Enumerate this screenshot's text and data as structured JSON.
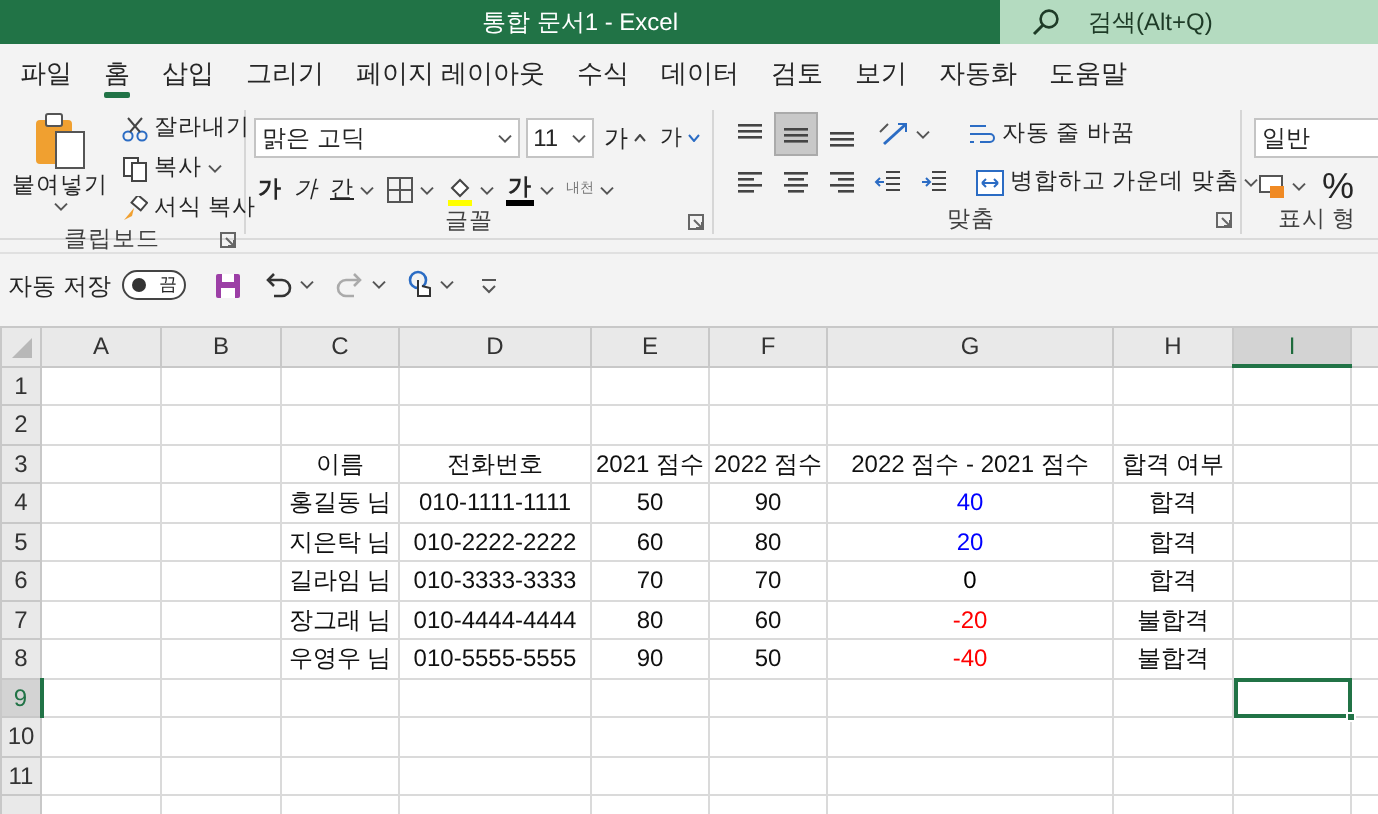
{
  "window": {
    "title": "통합 문서1  -  Excel"
  },
  "search": {
    "placeholder": "검색(Alt+Q)"
  },
  "tabs": [
    {
      "label": "파일",
      "selected": false
    },
    {
      "label": "홈",
      "selected": true
    },
    {
      "label": "삽입",
      "selected": false
    },
    {
      "label": "그리기",
      "selected": false
    },
    {
      "label": "페이지 레이아웃",
      "selected": false
    },
    {
      "label": "수식",
      "selected": false
    },
    {
      "label": "데이터",
      "selected": false
    },
    {
      "label": "검토",
      "selected": false
    },
    {
      "label": "보기",
      "selected": false
    },
    {
      "label": "자동화",
      "selected": false
    },
    {
      "label": "도움말",
      "selected": false
    }
  ],
  "ribbon": {
    "clipboard": {
      "paste": "붙여넣기",
      "cut": "잘라내기",
      "copy": "복사",
      "format_painter": "서식 복사",
      "label": "클립보드"
    },
    "font": {
      "font_name": "맑은 고딕",
      "font_size": "11",
      "grow": "가",
      "shrink": "가",
      "bold": "가",
      "italic": "가",
      "underline": "간",
      "font_color": "가",
      "phonetic": "내천",
      "label": "글꼴"
    },
    "alignment": {
      "vertical_align": [
        {
          "kind": "top",
          "selected": false
        },
        {
          "kind": "middle",
          "selected": true
        },
        {
          "kind": "bottom",
          "selected": false
        }
      ],
      "wrap_text": "자동 줄 바꿈",
      "merge": "병합하고 가운데 맞춤",
      "label": "맞춤"
    },
    "number": {
      "format": "일반",
      "percent": "%",
      "label": "표시 형"
    }
  },
  "quick_access": {
    "autosave_label": "자동 저장",
    "autosave_on": false,
    "autosave_state": "끔"
  },
  "sheet": {
    "columns": [
      {
        "label": "A",
        "selected": false
      },
      {
        "label": "B",
        "selected": false
      },
      {
        "label": "C",
        "selected": false
      },
      {
        "label": "D",
        "selected": false
      },
      {
        "label": "E",
        "selected": false
      },
      {
        "label": "F",
        "selected": false
      },
      {
        "label": "G",
        "selected": false
      },
      {
        "label": "H",
        "selected": false
      },
      {
        "label": "I",
        "selected": true
      }
    ],
    "rows": [
      {
        "number": "1",
        "selected": false,
        "cells": []
      },
      {
        "number": "2",
        "selected": false,
        "cells": []
      },
      {
        "number": "3",
        "selected": false,
        "cells": [
          {
            "text": ""
          },
          {
            "text": ""
          },
          {
            "text": "이름"
          },
          {
            "text": "전화번호"
          },
          {
            "text": "2021 점수"
          },
          {
            "text": "2022 점수"
          },
          {
            "text": "2022 점수 - 2021 점수"
          },
          {
            "text": "합격 여부"
          }
        ]
      },
      {
        "number": "4",
        "selected": false,
        "cells": [
          {
            "text": ""
          },
          {
            "text": ""
          },
          {
            "text": "홍길동 님"
          },
          {
            "text": "010-1111-1111"
          },
          {
            "text": "50"
          },
          {
            "text": "90"
          },
          {
            "text": "40",
            "color": "#0000ff"
          },
          {
            "text": "합격"
          }
        ]
      },
      {
        "number": "5",
        "selected": false,
        "cells": [
          {
            "text": ""
          },
          {
            "text": ""
          },
          {
            "text": "지은탁 님"
          },
          {
            "text": "010-2222-2222"
          },
          {
            "text": "60"
          },
          {
            "text": "80"
          },
          {
            "text": "20",
            "color": "#0000ff"
          },
          {
            "text": "합격"
          }
        ]
      },
      {
        "number": "6",
        "selected": false,
        "cells": [
          {
            "text": ""
          },
          {
            "text": ""
          },
          {
            "text": "길라임 님"
          },
          {
            "text": "010-3333-3333"
          },
          {
            "text": "70"
          },
          {
            "text": "70"
          },
          {
            "text": "0",
            "color": "#000000"
          },
          {
            "text": "합격"
          }
        ]
      },
      {
        "number": "7",
        "selected": false,
        "cells": [
          {
            "text": ""
          },
          {
            "text": ""
          },
          {
            "text": "장그래 님"
          },
          {
            "text": "010-4444-4444"
          },
          {
            "text": "80"
          },
          {
            "text": "60"
          },
          {
            "text": "-20",
            "color": "#ff0000"
          },
          {
            "text": "불합격"
          }
        ]
      },
      {
        "number": "8",
        "selected": false,
        "cells": [
          {
            "text": ""
          },
          {
            "text": ""
          },
          {
            "text": "우영우 님"
          },
          {
            "text": "010-5555-5555"
          },
          {
            "text": "90"
          },
          {
            "text": "50"
          },
          {
            "text": "-40",
            "color": "#ff0000"
          },
          {
            "text": "불합격"
          }
        ]
      },
      {
        "number": "9",
        "selected": true,
        "cells": []
      },
      {
        "number": "10",
        "selected": false,
        "cells": []
      },
      {
        "number": "11",
        "selected": false,
        "cells": []
      }
    ]
  }
}
